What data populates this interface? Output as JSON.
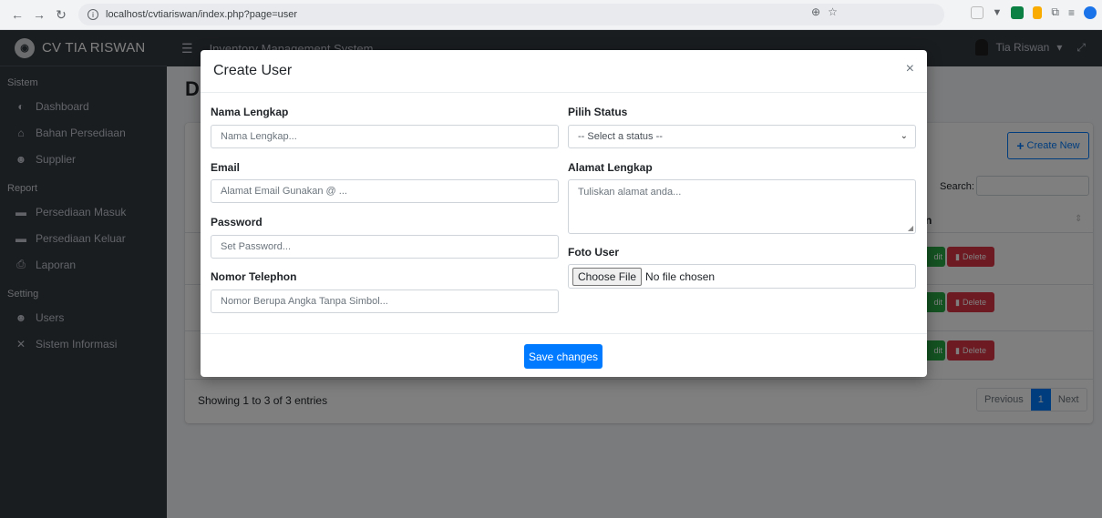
{
  "browser": {
    "url": "localhost/cvtiariswan/index.php?page=user"
  },
  "sidebar": {
    "brand": "CV TIA RISWAN",
    "sections": [
      {
        "header": "Sistem",
        "items": [
          {
            "label": "Dashboard",
            "icon": "tachometer-icon"
          },
          {
            "label": "Bahan Persediaan",
            "icon": "warehouse-icon"
          },
          {
            "label": "Supplier",
            "icon": "users-icon"
          }
        ]
      },
      {
        "header": "Report",
        "items": [
          {
            "label": "Persediaan Masuk",
            "icon": "inbox-in-icon"
          },
          {
            "label": "Persediaan Keluar",
            "icon": "inbox-out-icon"
          },
          {
            "label": "Laporan",
            "icon": "print-icon"
          }
        ]
      },
      {
        "header": "Setting",
        "items": [
          {
            "label": "Users",
            "icon": "users-cog-icon"
          },
          {
            "label": "Sistem Informasi",
            "icon": "tools-icon"
          }
        ]
      }
    ]
  },
  "topnav": {
    "title": "Inventory Management System",
    "user": "Tia Riswan"
  },
  "content": {
    "heading": "D",
    "create_button": "Create New",
    "search_label": "Search:",
    "table_header_action": "n",
    "row_buttons": {
      "edit": "dit",
      "delete": "Delete"
    },
    "showing": "Showing 1 to 3 of 3 entries",
    "pagination": {
      "previous": "Previous",
      "current": "1",
      "next": "Next"
    }
  },
  "modal": {
    "title": "Create User",
    "close": "×",
    "fields": {
      "nama": {
        "label": "Nama Lengkap",
        "placeholder": "Nama Lengkap..."
      },
      "email": {
        "label": "Email",
        "placeholder": "Alamat Email Gunakan @ ..."
      },
      "password": {
        "label": "Password",
        "placeholder": "Set Password..."
      },
      "telepon": {
        "label": "Nomor Telephon",
        "placeholder": "Nomor Berupa Angka Tanpa Simbol..."
      },
      "status": {
        "label": "Pilih Status",
        "selected": "-- Select a status --"
      },
      "alamat": {
        "label": "Alamat Lengkap",
        "placeholder": "Tuliskan alamat anda..."
      },
      "foto": {
        "label": "Foto User",
        "button": "Choose File",
        "status": "No file chosen"
      }
    },
    "save_button": "Save changes"
  }
}
